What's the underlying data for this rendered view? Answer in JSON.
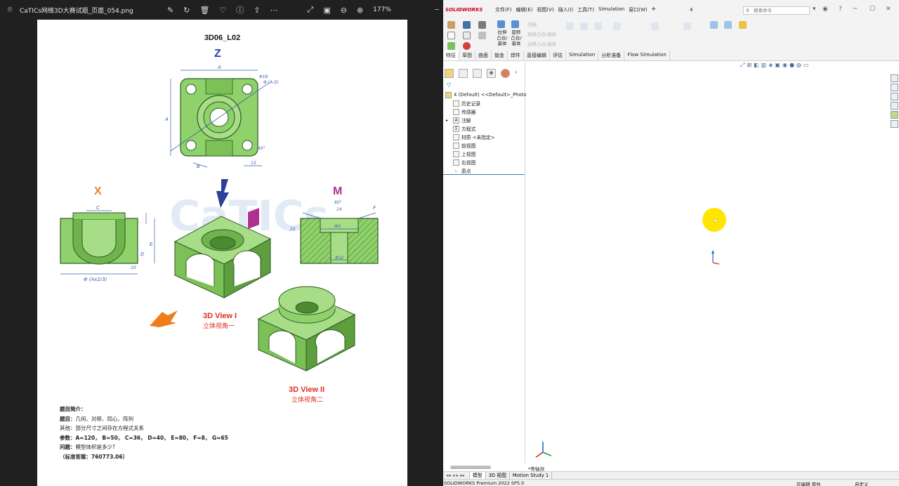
{
  "viewer": {
    "filename": "CaTICs网络3D大赛试题_页面_054.png",
    "zoom": "177%",
    "app_icon": "photos-app-icon"
  },
  "paper": {
    "title": "3D06_L02",
    "letters": {
      "z": "Z",
      "x": "X",
      "m": "M"
    },
    "view1_label": "3D View I",
    "view1_sub": "立体视角一",
    "view2_label": "3D View II",
    "view2_sub": "立体视角二",
    "dim_labels": {
      "a_top": "A",
      "a_left": "A",
      "hole_phi": "Φ18",
      "hole_spec": "Φ (A-5)",
      "angle": "45°",
      "b": "B",
      "d15": "15",
      "c": "C",
      "e": "E",
      "d": "D",
      "d10": "10",
      "phi_ax": "Φ (Ax2/3)",
      "d60": "60°",
      "d14": "14",
      "f": "F",
      "d25": "25",
      "g": "ΦG",
      "d32": "Φ32"
    },
    "watermark": "CaTICs"
  },
  "notes": {
    "heading": "题目简介：",
    "topic_label": "题目：",
    "topic": "几何、对称、同心、阵列",
    "other_label": "其他：",
    "other": "部分尺寸之间存在方程式关系",
    "params_label": "参数：",
    "params": "A=120，  B=50，  C=36，  D=40，  E=80，  F=8，  G=65",
    "question_label": "问题：",
    "question": "模型体积是多少?",
    "answer": "（标准答案：760773.06）"
  },
  "solidworks": {
    "logo": "SOLIDWORKS",
    "menu": [
      "文件(F)",
      "编辑(E)",
      "视图(V)",
      "插入(I)",
      "工具(T)",
      "Simulation",
      "窗口(W)"
    ],
    "doc_name": "4",
    "search_placeholder": "搜索命令",
    "commands": {
      "extrude_boss": "拉伸\n凸台/\n基体",
      "revolve_boss": "旋转\n凸台/\n基体",
      "scan": "扫描",
      "loft_boss": "放样凸台/基体",
      "boundary_boss": "边界凸台/基体"
    },
    "tabs": [
      "特征",
      "草图",
      "曲面",
      "钣金",
      "焊件",
      "直接编辑",
      "评估",
      "Simulation",
      "分析准备",
      "Flow Simulation"
    ],
    "active_tab": 0,
    "tree_root": "4 (Default) <<Default>_Photo",
    "tree": [
      "历史记录",
      "传感器",
      "注解",
      "方程式",
      "材质 <未指定>",
      "前视图",
      "上视图",
      "右视图",
      "原点"
    ],
    "view_label": "*等轴测",
    "bottom_tabs": [
      "模型",
      "3D 视图",
      "Motion Study 1"
    ],
    "status_left": "SOLIDWORKS Premium 2022 SP5.0",
    "status_mid": "在编辑 零件",
    "status_right": "自定义"
  },
  "colors": {
    "part_green": "#8fd16a",
    "part_dark": "#3f7a2a",
    "dim_blue": "#3a5fb0",
    "label_red": "#e03020",
    "z_blue": "#2d3f9a",
    "x_orange": "#f07d1d",
    "m_magenta": "#b03090",
    "sw_red": "#d0021b"
  }
}
